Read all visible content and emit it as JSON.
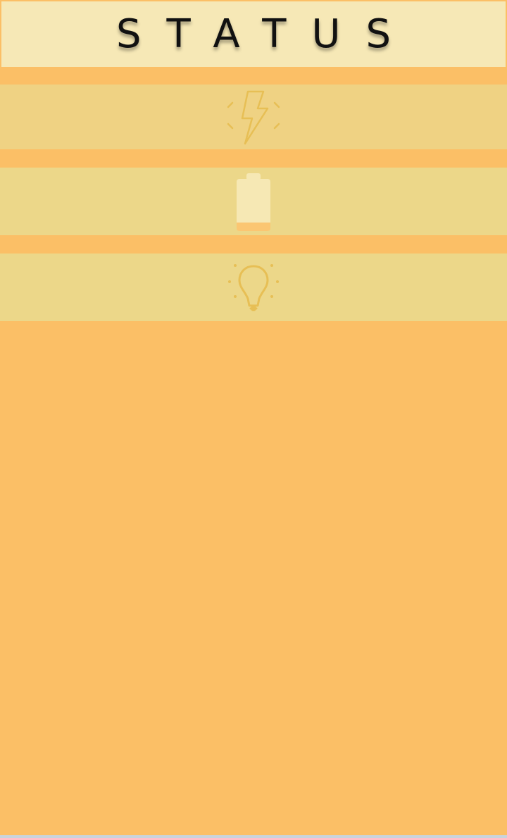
{
  "header": {
    "title": "STATUS"
  },
  "rows": [
    {
      "icon": "power-icon"
    },
    {
      "icon": "battery-icon",
      "level": 0.15
    },
    {
      "icon": "lightbulb-icon"
    }
  ],
  "colors": {
    "background": "#fbbf66",
    "header_background": "#f6e8b6",
    "row_background": "#ecd789",
    "icon_stroke": "#e7bf55",
    "battery_body": "#f6e8b4",
    "battery_fill": "#fbbf66"
  }
}
